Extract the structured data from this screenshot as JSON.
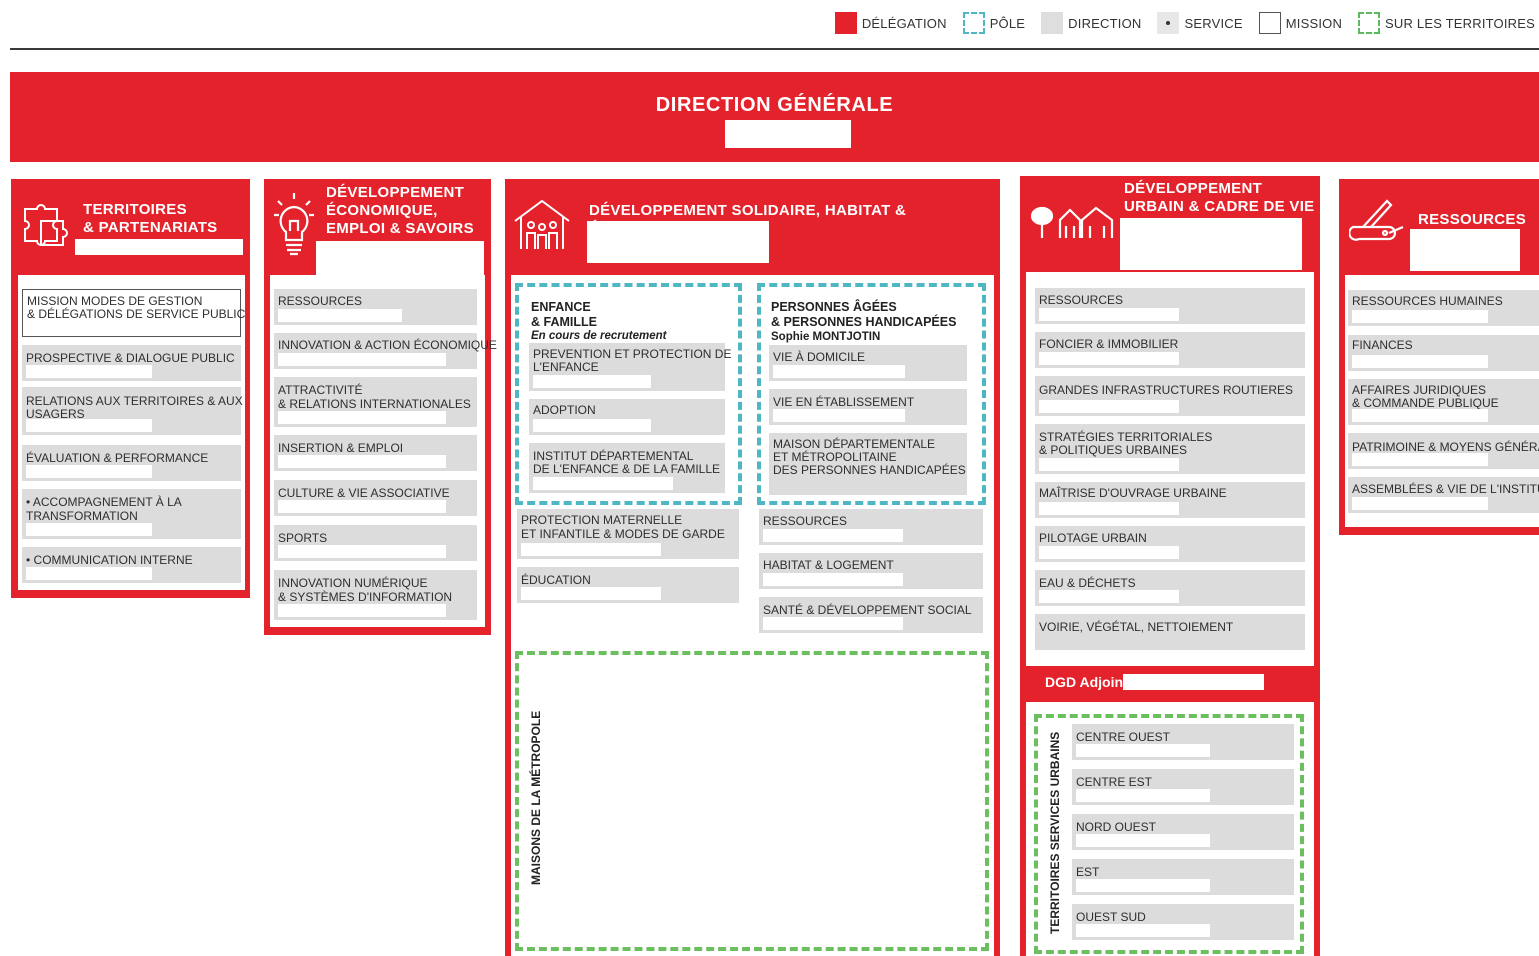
{
  "legend": {
    "delegation": "DÉLÉGATION",
    "pole": "PÔLE",
    "direction": "DIRECTION",
    "service": "SERVICE",
    "mission": "MISSION",
    "territoires": "SUR LES TERRITOIRES"
  },
  "colors": {
    "delegation": "#e3222b",
    "pole": "#4fb7c3",
    "direction": "#dcdcdc",
    "territoires": "#6cbf5e"
  },
  "direction_generale": {
    "title": "DIRECTION GÉNÉRALE"
  },
  "col1": {
    "title_1": "TERRITOIRES",
    "title_2": "& PARTENARIATS",
    "icon": "puzzle-icon",
    "items": [
      "MISSION MODES DE GESTION",
      "& DÉLÉGATIONS DE SERVICE PUBLIC",
      "PROSPECTIVE & DIALOGUE PUBLIC",
      "RELATIONS AUX TERRITOIRES & AUX",
      "USAGERS",
      "ÉVALUATION & PERFORMANCE",
      "• ACCOMPAGNEMENT À LA",
      "TRANSFORMATION",
      "• COMMUNICATION INTERNE"
    ]
  },
  "col2": {
    "title_1": "DÉVELOPPEMENT",
    "title_2": "ÉCONOMIQUE,",
    "title_3": "EMPLOI & SAVOIRS",
    "icon": "lightbulb-icon",
    "items": [
      "RESSOURCES",
      "INNOVATION & ACTION ÉCONOMIQUE",
      "ATTRACTIVITÉ",
      "& RELATIONS INTERNATIONALES",
      "INSERTION & EMPLOI",
      "CULTURE & VIE ASSOCIATIVE",
      "SPORTS",
      "INNOVATION NUMÉRIQUE",
      "& SYSTÈMES D'INFORMATION"
    ]
  },
  "col3": {
    "title": "DÉVELOPPEMENT SOLIDAIRE, HABITAT & ÉDUCATION",
    "icon": "family-house-icon",
    "pole1": {
      "title_1": "ENFANCE",
      "title_2": "& FAMILLE",
      "subtitle": "En cours de recrutement",
      "items": [
        "PREVENTION ET PROTECTION DE",
        "L'ENFANCE",
        "ADOPTION",
        "INSTITUT DÉPARTEMENTAL",
        "DE L'ENFANCE & DE LA FAMILLE"
      ]
    },
    "pole2": {
      "title_1": "PERSONNES ÂGÉES",
      "title_2": "& PERSONNES HANDICAPÉES",
      "subtitle": "Sophie MONTJOTIN",
      "items": [
        "VIE À DOMICILE",
        "VIE EN ÉTABLISSEMENT",
        "MAISON DÉPARTEMENTALE",
        "ET MÉTROPOLITAINE",
        "DES PERSONNES HANDICAPÉES"
      ]
    },
    "left_items": [
      "PROTECTION MATERNELLE",
      "ET INFANTILE  & MODES DE GARDE",
      "ÉDUCATION"
    ],
    "right_items": [
      "RESSOURCES",
      "HABITAT & LOGEMENT",
      "SANTÉ & DÉVELOPPEMENT SOCIAL"
    ],
    "maisons": "MAISONS DE LA MÉTROPOLE"
  },
  "col4": {
    "title_1": "DÉVELOPPEMENT",
    "title_2": "URBAIN & CADRE DE VIE",
    "icon": "city-tree-icon",
    "items": [
      "RESSOURCES",
      "FONCIER & IMMOBILIER",
      "GRANDES INFRASTRUCTURES ROUTIERES",
      "STRATÉGIES TERRITORIALES",
      "& POLITIQUES URBAINES",
      "MAÎTRISE D'OUVRAGE URBAINE",
      "PILOTAGE URBAIN",
      "EAU & DÉCHETS",
      "VOIRIE, VÉGÉTAL, NETTOIEMENT"
    ],
    "dgd": "DGD Adjoint",
    "territoires_label": "TERRITOIRES SERVICES URBAINS",
    "territoires": [
      "CENTRE OUEST",
      "CENTRE EST",
      "NORD OUEST",
      "EST",
      "OUEST SUD"
    ]
  },
  "col5": {
    "title": "RESSOURCES",
    "icon": "swiss-knife-icon",
    "items": [
      "RESSOURCES HUMAINES",
      "FINANCES",
      "AFFAIRES JURIDIQUES",
      "& COMMANDE PUBLIQUE",
      "PATRIMOINE & MOYENS GÉNÉRAUX",
      "ASSEMBLÉES & VIE DE L'INSTITUTION"
    ]
  }
}
